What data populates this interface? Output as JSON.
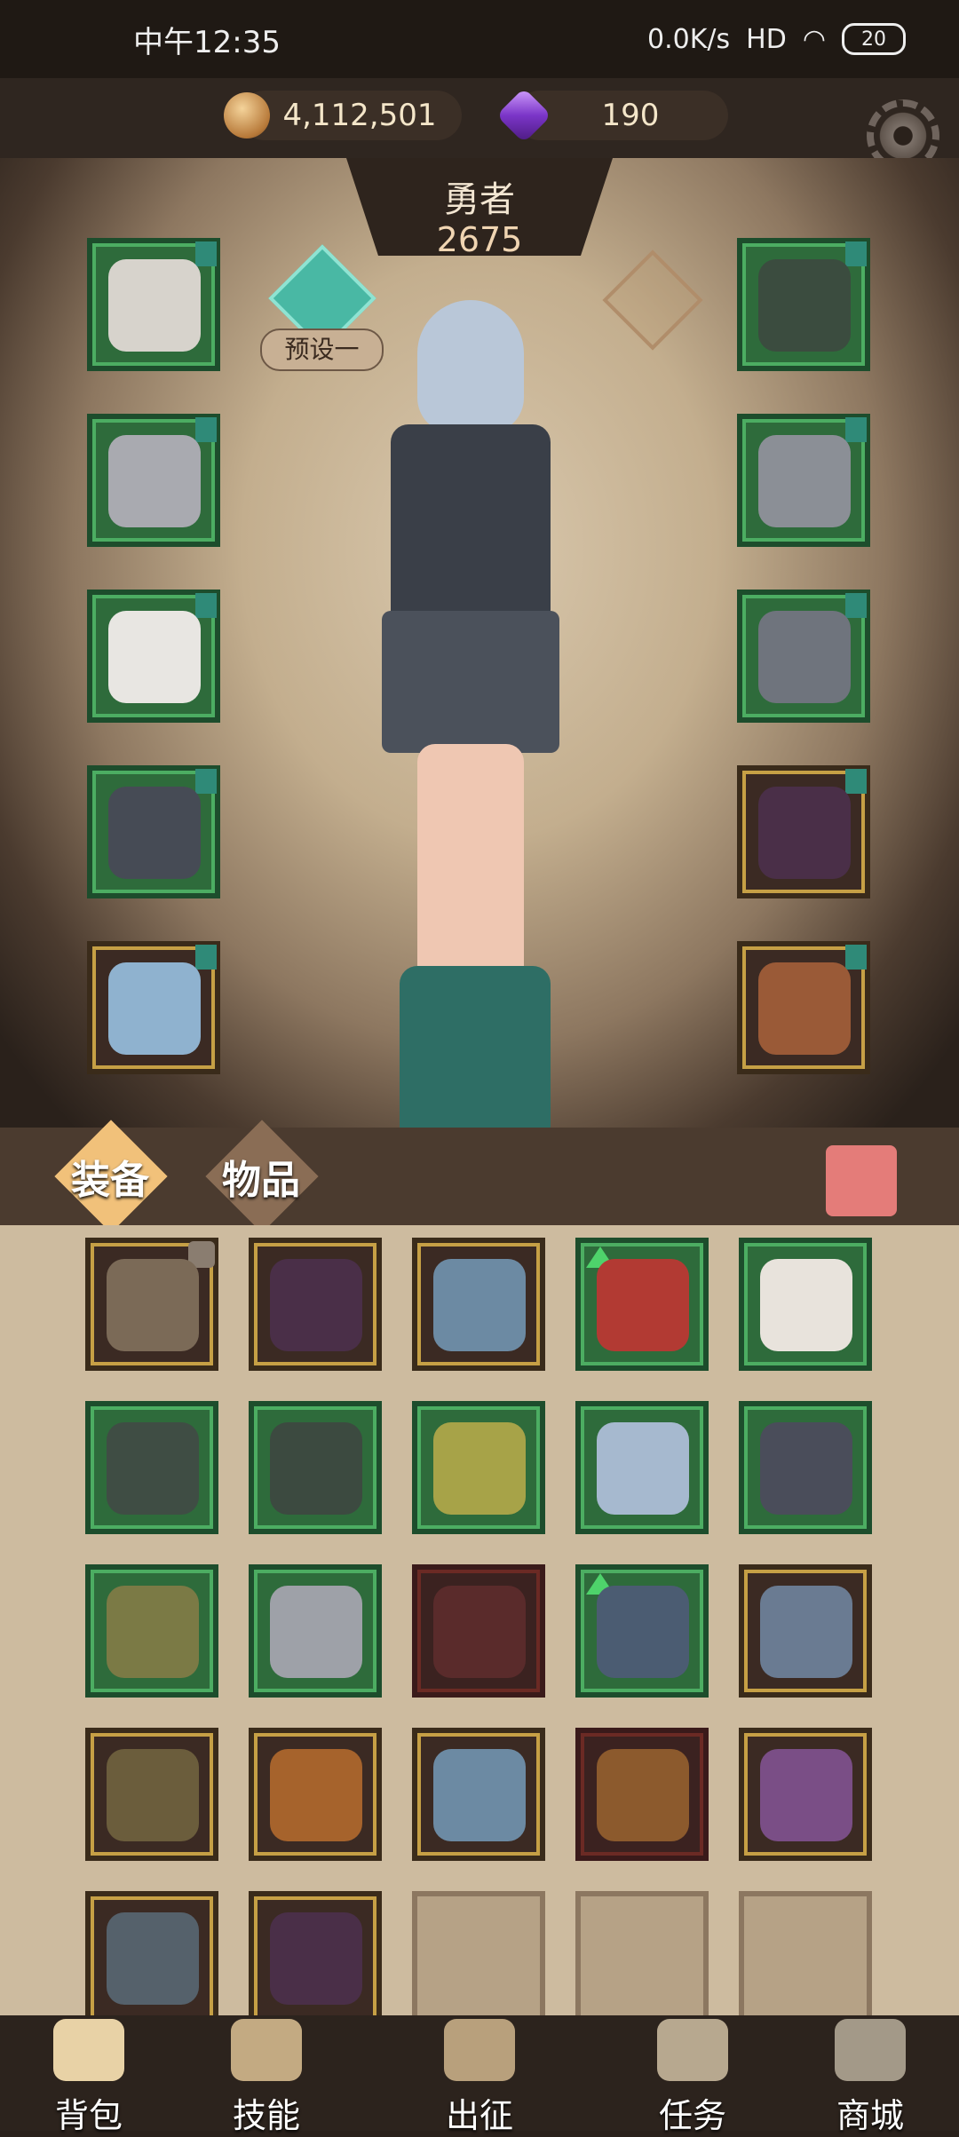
{
  "status_bar": {
    "time": "中午12:35",
    "network": "0.0K/s",
    "signal": "HD",
    "battery": "20"
  },
  "resources": {
    "gold": "4,112,501",
    "gems": "190"
  },
  "hero": {
    "name": "勇者",
    "power": "2675",
    "preset_label": "预设一"
  },
  "tabs": {
    "equip": "装备",
    "items": "物品"
  },
  "nav": {
    "backpack": "背包",
    "skills": "技能",
    "battle": "出征",
    "tasks": "任务",
    "shop": "商城"
  },
  "colors": {
    "accent_teal": "#49b8a4",
    "green_frame": "#4cad62",
    "gold_frame": "#c6a045"
  },
  "icons": [
    "gold-coin-icon",
    "gem-icon",
    "settings-gear-icon",
    "preset-icon",
    "trash-icon",
    "lock-icon",
    "upgrade-arrow-icon"
  ]
}
